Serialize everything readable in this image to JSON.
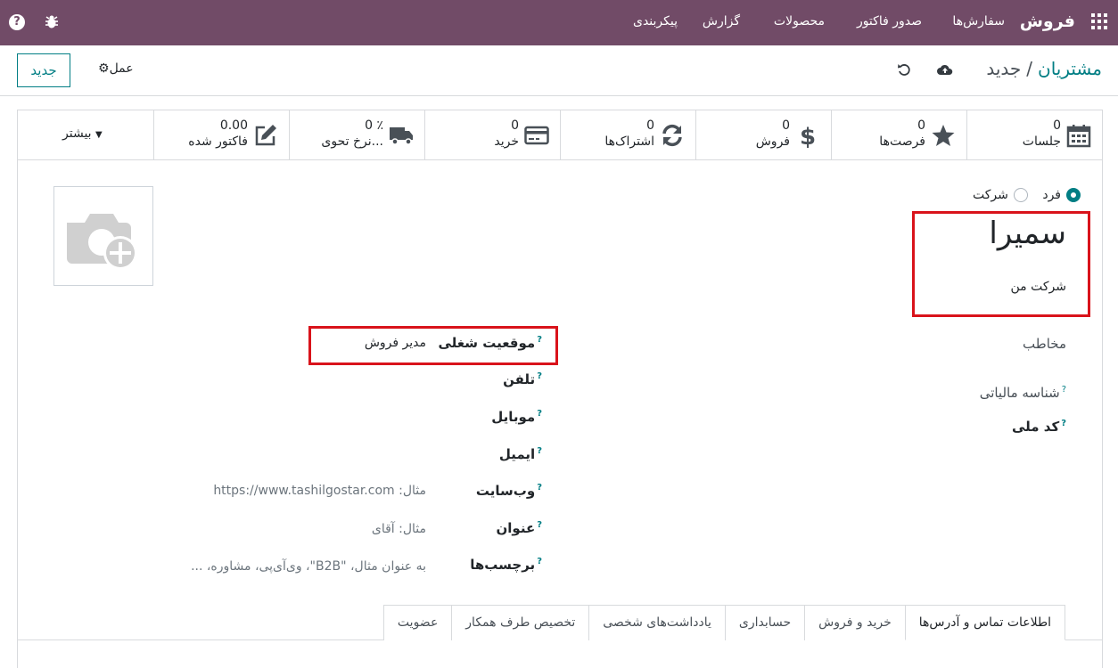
{
  "nav": {
    "brand": "فروش",
    "menu": [
      "سفارش‌ها",
      "صدور فاکتور",
      "محصولات",
      "گزارش",
      "پیکربندی"
    ],
    "help_glyph": "?"
  },
  "control": {
    "breadcrumb_parent": "مشتریان",
    "breadcrumb_sep": "/",
    "breadcrumb_current": "جدید",
    "new_button": "جدید",
    "action_button": "عمل"
  },
  "stats": [
    {
      "value": "0",
      "label": "جلسات",
      "icon": "calendar-icon"
    },
    {
      "value": "0",
      "label": "فرصت‌ها",
      "icon": "star-icon"
    },
    {
      "value": "0",
      "label": "فروش",
      "icon": "dollar-icon"
    },
    {
      "value": "0",
      "label": "اشتراک‌ها",
      "icon": "refresh-icon"
    },
    {
      "value": "0",
      "label": "خرید",
      "icon": "credit-card-icon"
    },
    {
      "value": "0 ٪",
      "label": "نرخ تحوی...",
      "icon": "truck-icon"
    },
    {
      "value": "0.00",
      "label": "فاکتور شده",
      "icon": "edit-icon"
    }
  ],
  "stat_more": "بیشتر",
  "partner": {
    "type_individual": "فرد",
    "type_company": "شرکت",
    "name": "سمیرا",
    "company": "شرکت من"
  },
  "fields_right": {
    "contact_label": "مخاطب",
    "tax_id_label": "شناسه مالیاتی",
    "national_code_label": "کد ملی"
  },
  "fields_left": {
    "job_position_label": "موقعیت شغلی",
    "job_position_value": "مدیر فروش",
    "phone_label": "تلفن",
    "mobile_label": "موبایل",
    "email_label": "ایمیل",
    "website_label": "وب‌سایت",
    "website_placeholder": "مثال: https://www.tashilgostar.com",
    "title_label": "عنوان",
    "title_placeholder": "مثال: آقای",
    "tags_label": "برچسب‌ها",
    "tags_placeholder": "به عنوان مثال، \"B2B\"، وی‌آی‌پی، مشاوره، ...",
    "help_mark": "?"
  },
  "tabs": [
    "اطلاعات تماس و آدرس‌ها",
    "خرید و فروش",
    "حسابداری",
    "یادداشت‌های شخصی",
    "تخصیص طرف همکار",
    "عضویت"
  ],
  "colors": {
    "brand": "#714b67",
    "accent": "#017e84",
    "highlight": "#d9131b"
  }
}
